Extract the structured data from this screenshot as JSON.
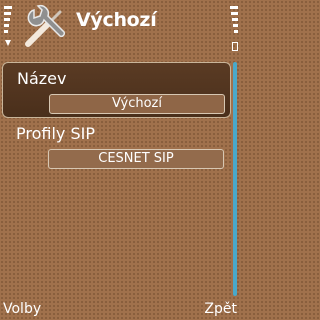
{
  "header": {
    "title": "Výchozí",
    "app_icon": "settings-tools-icon"
  },
  "status": {
    "signal_icon": "signal-strength-icon",
    "battery_icon": "battery-icon"
  },
  "items": [
    {
      "label": "Název",
      "value": "Výchozí",
      "selected": true
    },
    {
      "label": "Profily SIP",
      "value": "CESNET SIP",
      "selected": false
    }
  ],
  "softkeys": {
    "left": "Volby",
    "right": "Zpět"
  },
  "colors": {
    "background": "#a0714c",
    "selection": "#4f331f",
    "scrollbar": "#4aa9c9"
  }
}
